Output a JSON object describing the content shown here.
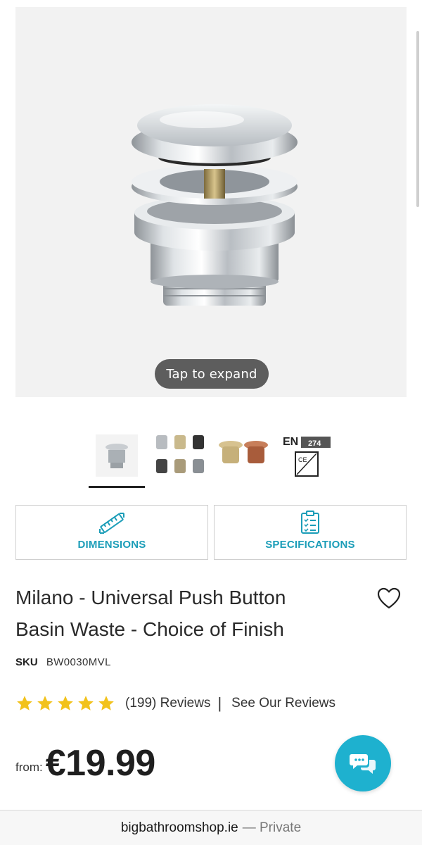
{
  "gallery": {
    "expand_label": "Tap to expand",
    "thumbnails": [
      {
        "name": "chrome-waste"
      },
      {
        "name": "finishes-grid"
      },
      {
        "name": "brass-copper"
      },
      {
        "name": "certification-marks",
        "en_label": "EN",
        "en_number": "274",
        "cert_top": "EUROPE",
        "ce": "CE",
        "ukca": "UK CA"
      }
    ]
  },
  "info_buttons": {
    "dimensions": "DIMENSIONS",
    "specifications": "SPECIFICATIONS"
  },
  "product": {
    "title_line1": "Milano - Universal Push Button",
    "title_line2": "Basin Waste - Choice of Finish",
    "sku_label": "SKU",
    "sku": "BW0030MVL",
    "rating_stars": 5,
    "reviews_count": "(199) Reviews",
    "separator": "|",
    "see_reviews": "See Our Reviews",
    "price_prefix": "from:",
    "price": "€19.99"
  },
  "colors": {
    "accent": "#1b9db8",
    "chat": "#1eb1cf",
    "star": "#f2c21b"
  },
  "url_bar": {
    "domain": "bigbathroomshop.ie",
    "suffix": "— Private"
  }
}
